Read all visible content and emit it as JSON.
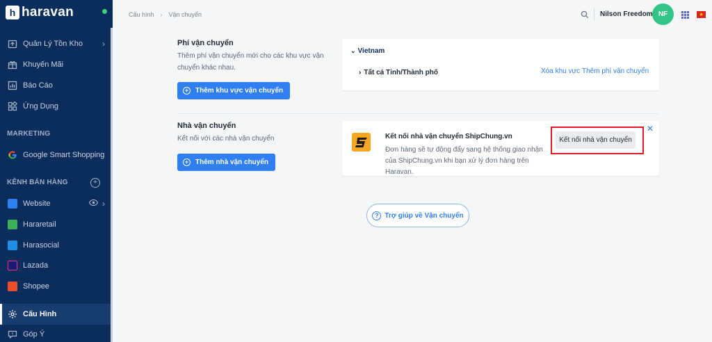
{
  "app": {
    "logo_text": "haravan"
  },
  "sidebar": {
    "items": [
      {
        "label": "Quản Lý Tồn Kho",
        "icon": "inventory-icon"
      },
      {
        "label": "Khuyến Mãi",
        "icon": "promotion-icon"
      },
      {
        "label": "Báo Cáo",
        "icon": "report-icon"
      },
      {
        "label": "Ứng Dụng",
        "icon": "apps-icon"
      }
    ],
    "marketing_title": "MARKETING",
    "marketing_items": [
      {
        "label": "Google Smart Shopping",
        "icon": "google-icon"
      }
    ],
    "sales_channels_title": "KÊNH BÁN HÀNG",
    "channels": [
      {
        "label": "Website",
        "color": "#2f7ff0"
      },
      {
        "label": "Hararetail",
        "color": "#3fae5a"
      },
      {
        "label": "Harasocial",
        "color": "#1f8fe3"
      },
      {
        "label": "Lazada",
        "color": "#1a1a6e"
      },
      {
        "label": "Shopee",
        "color": "#ee4d2d"
      }
    ],
    "config_label": "Cấu Hình",
    "feedback_label": "Góp Ý"
  },
  "header": {
    "breadcrumb": [
      "Cấu hình",
      "Vận chuyển"
    ],
    "breadcrumb_sep": "›",
    "user_name": "Nilson Freedome",
    "avatar_initials": "NF"
  },
  "shipping_fee": {
    "title": "Phí vận chuyển",
    "description": "Thêm phí vận chuyển mới cho các khu vực vận chuyển khác nhau.",
    "button": "Thêm khu vực vận chuyển",
    "country": "Vietnam",
    "region": "Tất cả Tỉnh/Thành phố",
    "delete_link": "Xóa khu vực",
    "add_fee_link": "Thêm phí vận chuyển"
  },
  "carriers": {
    "title": "Nhà vận chuyển",
    "description": "Kết nối với các nhà vận chuyển",
    "button": "Thêm nhà vận chuyển",
    "shipchung_title": "Kết nối nhà vận chuyển ShipChung.vn",
    "shipchung_desc": "Đơn hàng sẽ tự động đẩy sang hệ thống giao nhận của ShipChung.vn khi bạn xử lý đơn hàng trên Haravan.",
    "connect_button": "Kết nối nhà vận chuyển"
  },
  "help": {
    "label": "Trợ giúp về Vận chuyển"
  },
  "colors": {
    "sidebar_bg": "#0b2d5c",
    "primary": "#2f7ff0",
    "avatar": "#32c486",
    "highlight": "#e01b24"
  }
}
